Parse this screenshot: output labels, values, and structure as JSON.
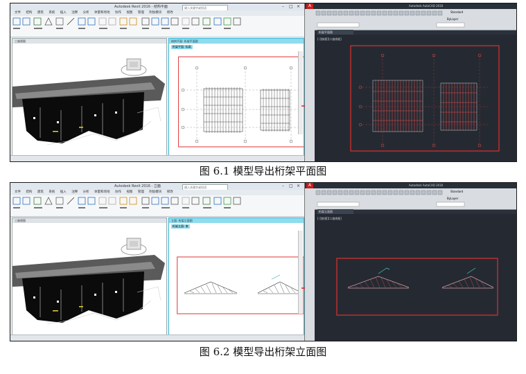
{
  "figures": [
    {
      "caption": "图 6.1 模型导出桁架平面图",
      "revit": {
        "app_title": "Autodesk Revit 2016 - 结构平面",
        "search_placeholder": "键入关键字或短语",
        "tabs": [
          "文件",
          "结构",
          "建筑",
          "系统",
          "插入",
          "注释",
          "分析",
          "体量和场地",
          "协作",
          "视图",
          "管理",
          "附加模块",
          "修改"
        ],
        "view_tabs": [
          "三维视图",
          "结构平面: 桁架平面图"
        ],
        "active_view_label": "桁架平面: 标高"
      },
      "cad": {
        "app_title": "Autodesk AutoCAD 2016",
        "file_tab": "桁架平面图",
        "view_label": "[-][俯视][二维线框]",
        "style_standard": "Standard",
        "layer": "ByLayer"
      }
    },
    {
      "caption": "图 6.2 模型导出桁架立面图",
      "revit": {
        "app_title": "Autodesk Revit 2016 - 立面",
        "search_placeholder": "键入关键字或短语",
        "tabs": [
          "文件",
          "结构",
          "建筑",
          "系统",
          "插入",
          "注释",
          "分析",
          "体量和场地",
          "协作",
          "视图",
          "管理",
          "附加模块",
          "修改"
        ],
        "view_tabs": [
          "三维视图",
          "立面: 桁架立面图"
        ],
        "active_view_label": "桁架立面: 南"
      },
      "cad": {
        "app_title": "Autodesk AutoCAD 2016",
        "file_tab": "桁架立面图",
        "view_label": "[-][前视][二维线框]",
        "style_standard": "Standard",
        "layer": "ByLayer"
      }
    }
  ],
  "colors": {
    "export_arrow": "#e02020",
    "cad_background": "#252a32",
    "active_view_tab": "#8fdcef",
    "red_frame": "#e03030"
  },
  "icons": [
    "window-minimize-icon",
    "window-maximize-icon",
    "window-close-icon",
    "view-cube-icon",
    "export-arrow-icon"
  ]
}
